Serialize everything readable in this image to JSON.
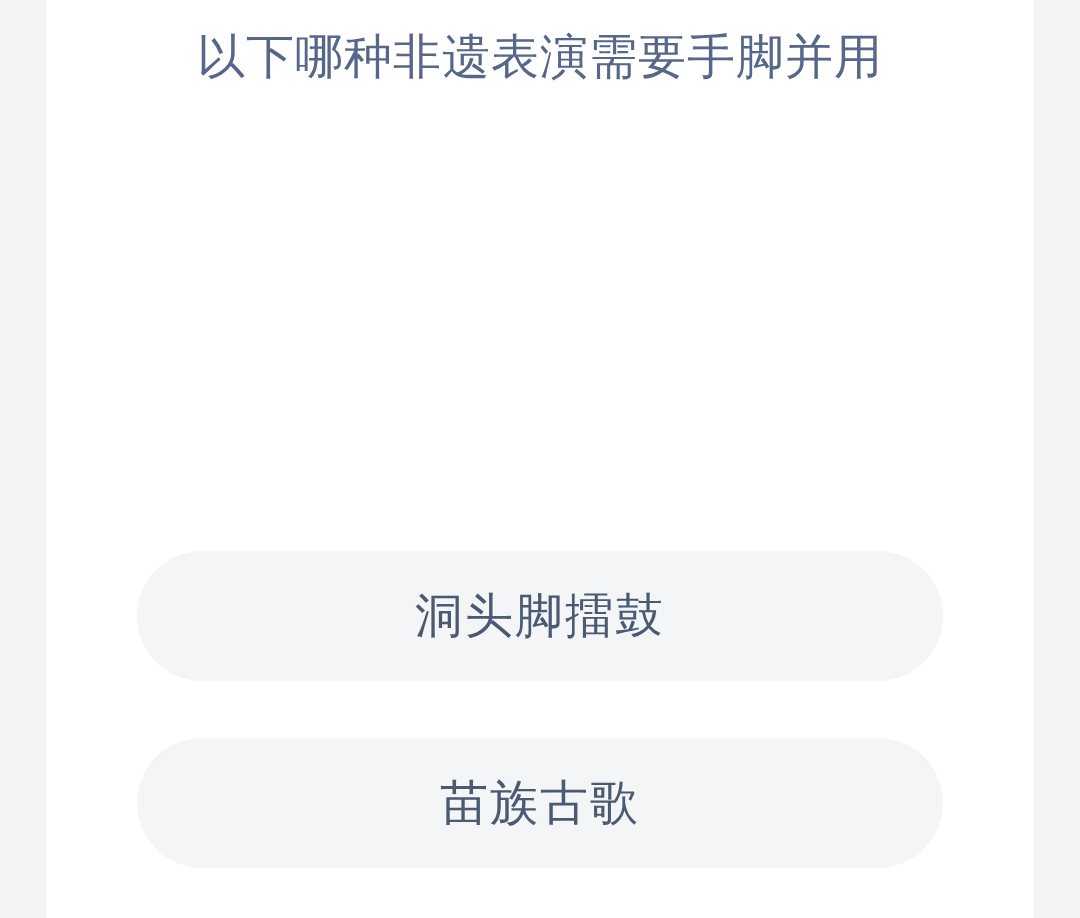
{
  "question": "以下哪种非遗表演需要手脚并用",
  "options": [
    {
      "label": "洞头脚擂鼓"
    },
    {
      "label": "苗族古歌"
    }
  ]
}
